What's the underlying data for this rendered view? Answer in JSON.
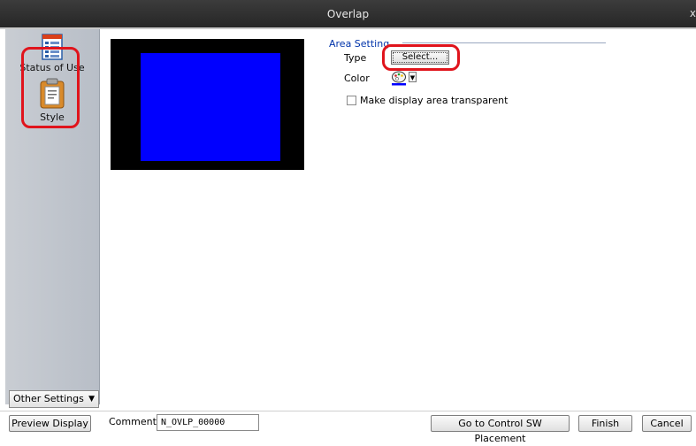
{
  "window": {
    "title": "Overlap",
    "close_glyph": "x"
  },
  "sidebar": {
    "items": [
      {
        "label": "Status of Use",
        "icon": "status-of-use-icon"
      },
      {
        "label": "Style",
        "icon": "style-icon",
        "selected": true
      }
    ],
    "other_settings_label": "Other Settings"
  },
  "preview": {
    "background_color": "#000000",
    "area_color": "#0000ff"
  },
  "area_setting": {
    "title": "Area Setting",
    "type_label": "Type",
    "select_button_label": "Select...",
    "color_label": "Color",
    "transparent_label": "Make display area transparent",
    "transparent_checked": false
  },
  "footer": {
    "preview_button_label": "Preview Display",
    "comment_label": "Comment",
    "comment_value": "N_OVLP_00000",
    "go_to_control_label": "Go to Control SW Placement",
    "finish_label": "Finish",
    "cancel_label": "Cancel"
  },
  "colors": {
    "highlight": "#e0141c",
    "titlebar": "#2e2e2e",
    "accent": "#0033aa"
  }
}
